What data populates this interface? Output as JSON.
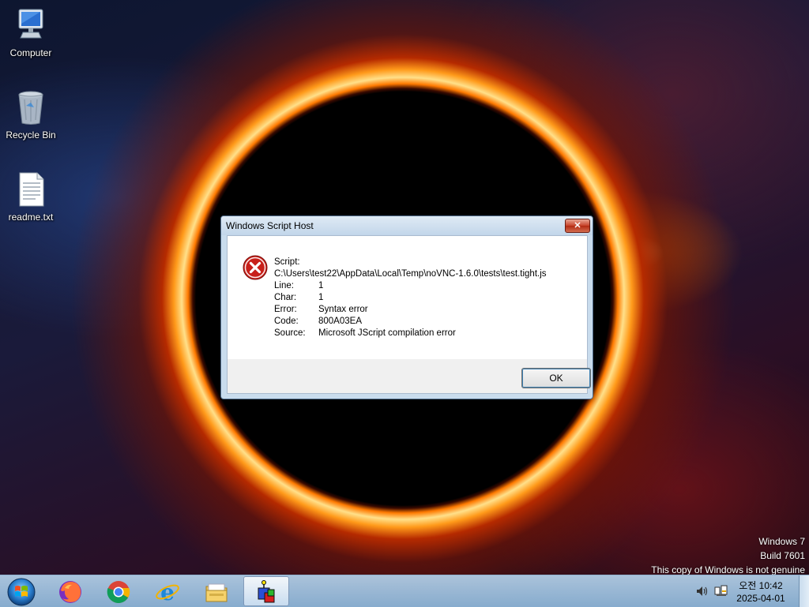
{
  "desktop": {
    "icons": [
      {
        "label": "Computer",
        "icon": "computer-icon"
      },
      {
        "label": "Recycle Bin",
        "icon": "recycle-bin-icon"
      },
      {
        "label": "readme.txt",
        "icon": "text-file-icon"
      }
    ]
  },
  "dialog": {
    "title": "Windows Script Host",
    "close_label": "✕",
    "icon": "error-icon",
    "script_label": "Script:",
    "script_path": "C:\\Users\\test22\\AppData\\Local\\Temp\\noVNC-1.6.0\\tests\\test.tight.js",
    "rows": [
      {
        "key": "Line:",
        "value": "1"
      },
      {
        "key": "Char:",
        "value": "1"
      },
      {
        "key": "Error:",
        "value": "Syntax error"
      },
      {
        "key": "Code:",
        "value": "800A03EA"
      },
      {
        "key": "Source:",
        "value": "Microsoft JScript compilation error"
      }
    ],
    "ok_label": "OK"
  },
  "watermark": {
    "line1": "Windows 7",
    "line2": "Build 7601",
    "line3": "This copy of Windows is not genuine"
  },
  "taskbar": {
    "items": [
      "start-orb-icon",
      "firefox-icon",
      "chrome-icon",
      "internet-explorer-icon",
      "file-explorer-icon",
      "vnc-app-icon"
    ],
    "clock_time": "오전 10:42",
    "clock_date": "2025-04-01",
    "tray": [
      "volume-icon",
      "network-icon"
    ]
  },
  "colors": {
    "dialog_border": "#4e6a89",
    "taskbar": "#a8c6e2",
    "error_red": "#c8201a"
  }
}
